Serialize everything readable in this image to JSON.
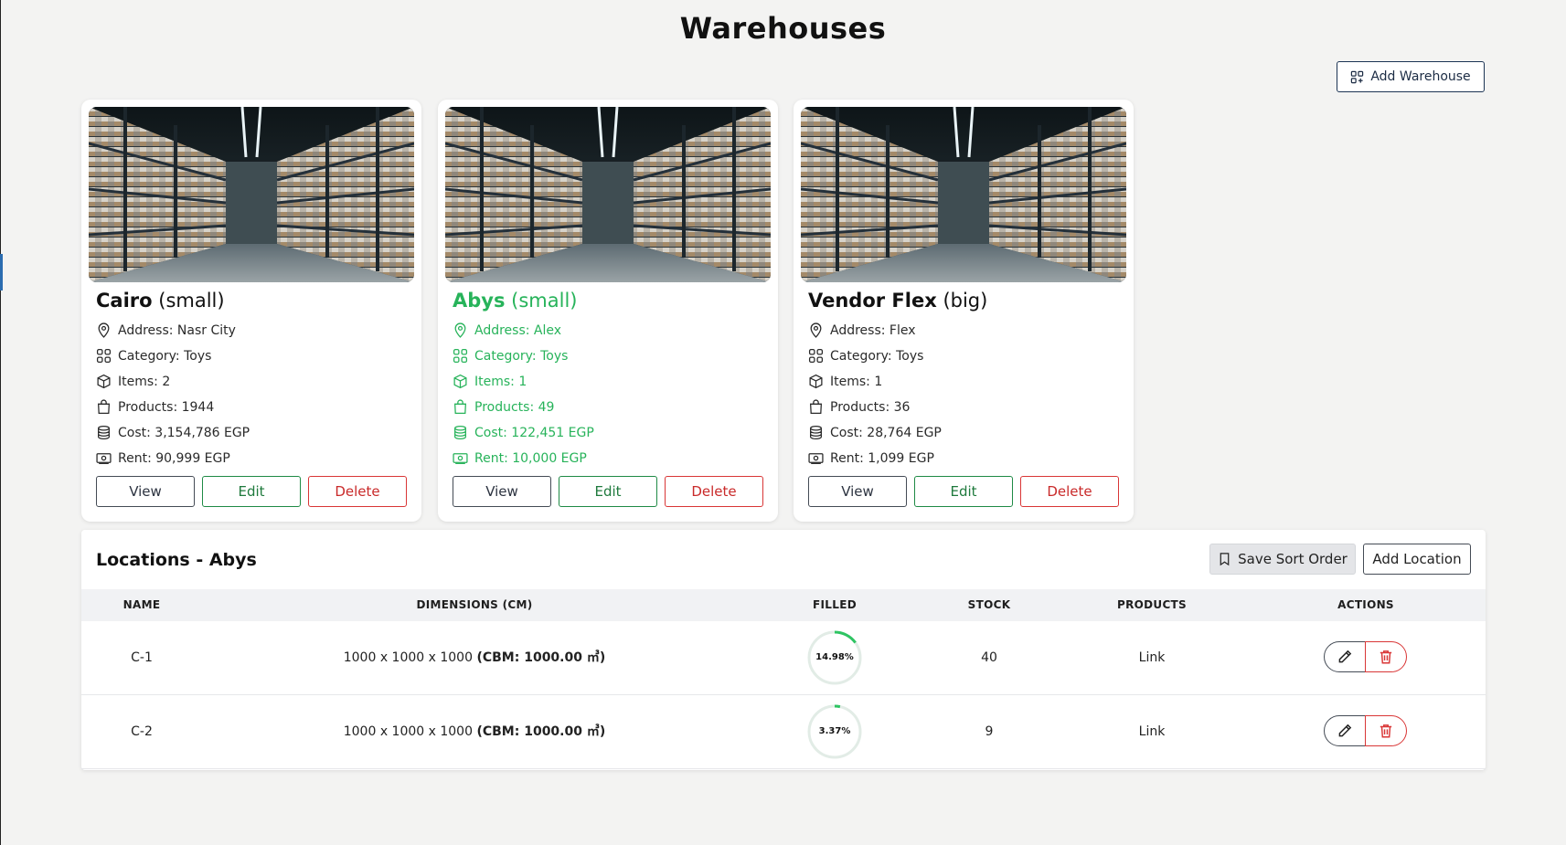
{
  "page": {
    "title": "Warehouses",
    "add_button": "Add Warehouse"
  },
  "colors": {
    "active": "#27b35a",
    "edit": "#1f8a45",
    "delete": "#d93636",
    "gauge": "#2ec462"
  },
  "warehouses": [
    {
      "name": "Cairo",
      "size": "(small)",
      "address": "Address: Nasr City",
      "category": "Category: Toys",
      "items": "Items: 2",
      "products": "Products: 1944",
      "cost": "Cost: 3,154,786 EGP",
      "rent": "Rent: 90,999 EGP",
      "view": "View",
      "edit": "Edit",
      "delete": "Delete",
      "selected": false
    },
    {
      "name": "Abys",
      "size": "(small)",
      "address": "Address: Alex",
      "category": "Category: Toys",
      "items": "Items: 1",
      "products": "Products: 49",
      "cost": "Cost: 122,451 EGP",
      "rent": "Rent: 10,000 EGP",
      "view": "View",
      "edit": "Edit",
      "delete": "Delete",
      "selected": true
    },
    {
      "name": "Vendor Flex",
      "size": "(big)",
      "address": "Address: Flex",
      "category": "Category: Toys",
      "items": "Items: 1",
      "products": "Products: 36",
      "cost": "Cost: 28,764 EGP",
      "rent": "Rent: 1,099 EGP",
      "view": "View",
      "edit": "Edit",
      "delete": "Delete",
      "selected": false
    }
  ],
  "locations": {
    "title": "Locations - Abys",
    "save_sort": "Save Sort Order",
    "add_location": "Add Location",
    "headers": [
      "NAME",
      "DIMENSIONS (CM)",
      "FILLED",
      "STOCK",
      "PRODUCTS",
      "ACTIONS"
    ],
    "rows": [
      {
        "name": "C-1",
        "dims": "1000 x 1000 x 1000",
        "cbm": "(CBM: 1000.00 ㎥)",
        "filled_label": "14.98%",
        "filled": 0.1498,
        "stock": "40",
        "products": "Link"
      },
      {
        "name": "C-2",
        "dims": "1000 x 1000 x 1000",
        "cbm": "(CBM: 1000.00 ㎥)",
        "filled_label": "3.37%",
        "filled": 0.0337,
        "stock": "9",
        "products": "Link"
      }
    ]
  }
}
